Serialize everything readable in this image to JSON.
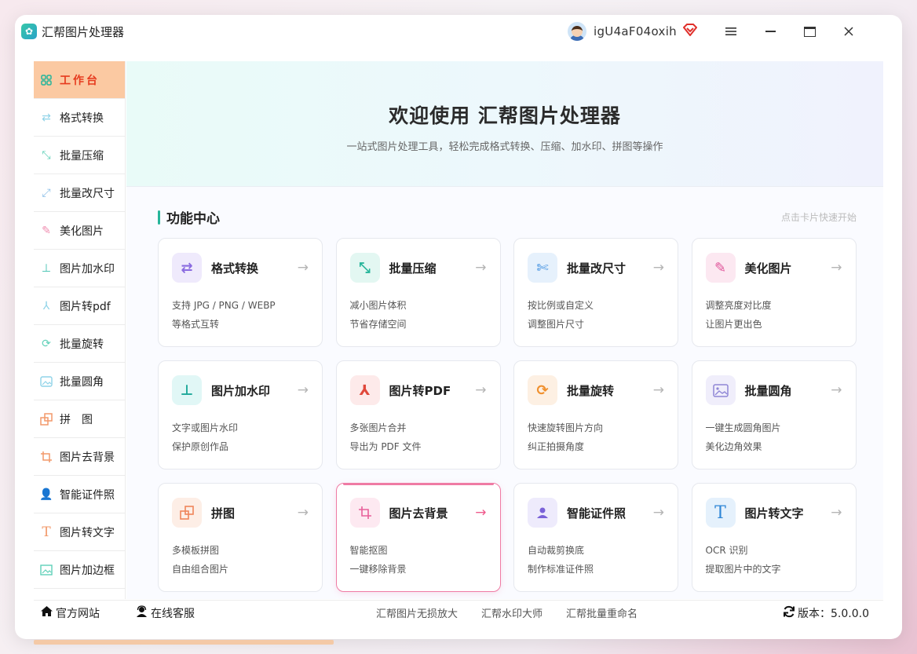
{
  "app": {
    "title": "汇帮图片处理器"
  },
  "user": {
    "name": "igU4aF04oxih"
  },
  "sidebar": {
    "items": [
      {
        "label": "工作台",
        "icon": "dashboard-icon",
        "active": true
      },
      {
        "label": "格式转换",
        "icon": "convert-icon"
      },
      {
        "label": "批量压缩",
        "icon": "compress-icon"
      },
      {
        "label": "批量改尺寸",
        "icon": "resize-icon"
      },
      {
        "label": "美化图片",
        "icon": "beautify-icon"
      },
      {
        "label": "图片加水印",
        "icon": "watermark-icon"
      },
      {
        "label": "图片转pdf",
        "icon": "pdf-icon"
      },
      {
        "label": "批量旋转",
        "icon": "rotate-icon"
      },
      {
        "label": "批量圆角",
        "icon": "round-corner-icon"
      },
      {
        "label": "拼　图",
        "icon": "collage-icon"
      },
      {
        "label": "图片去背景",
        "icon": "crop-icon"
      },
      {
        "label": "智能证件照",
        "icon": "person-icon"
      },
      {
        "label": "图片转文字",
        "icon": "text-icon"
      },
      {
        "label": "图片加边框",
        "icon": "frame-icon"
      }
    ]
  },
  "hero": {
    "title": "欢迎使用 汇帮图片处理器",
    "subtitle": "一站式图片处理工具，轻松完成格式转换、压缩、加水印、拼图等操作"
  },
  "section": {
    "title": "功能中心",
    "hint": "点击卡片快速开始"
  },
  "cards": [
    {
      "title": "格式转换",
      "desc1": "支持 JPG / PNG / WEBP",
      "desc2": "等格式互转",
      "arrow": "→"
    },
    {
      "title": "批量压缩",
      "desc1": "减小图片体积",
      "desc2": "节省存储空间",
      "arrow": "→"
    },
    {
      "title": "批量改尺寸",
      "desc1": "按比例或自定义",
      "desc2": "调整图片尺寸",
      "arrow": "→"
    },
    {
      "title": "美化图片",
      "desc1": "调整亮度对比度",
      "desc2": "让图片更出色",
      "arrow": "→"
    },
    {
      "title": "图片加水印",
      "desc1": "文字或图片水印",
      "desc2": "保护原创作品",
      "arrow": "→"
    },
    {
      "title": "图片转PDF",
      "desc1": "多张图片合并",
      "desc2": "导出为 PDF 文件",
      "arrow": "→"
    },
    {
      "title": "批量旋转",
      "desc1": "快速旋转图片方向",
      "desc2": "纠正拍摄角度",
      "arrow": "→"
    },
    {
      "title": "批量圆角",
      "desc1": "一键生成圆角图片",
      "desc2": "美化边角效果",
      "arrow": "→"
    },
    {
      "title": "拼图",
      "desc1": "多模板拼图",
      "desc2": "自由组合图片",
      "arrow": "→"
    },
    {
      "title": "图片去背景",
      "desc1": "智能抠图",
      "desc2": "一键移除背景",
      "arrow": "→"
    },
    {
      "title": "智能证件照",
      "desc1": "自动裁剪换底",
      "desc2": "制作标准证件照",
      "arrow": "→"
    },
    {
      "title": "图片转文字",
      "desc1": "OCR 识别",
      "desc2": "提取图片中的文字",
      "arrow": "→"
    }
  ],
  "footer": {
    "website": "官方网站",
    "support": "在线客服",
    "links": [
      "汇帮图片无损放大",
      "汇帮水印大师",
      "汇帮批量重命名"
    ],
    "version": "版本：5.0.0.0"
  },
  "colors": {
    "accent": "#26b59a",
    "sidebar_active_bg": "#fbc9a2",
    "sidebar_active_text": "#e63b1f",
    "hover_border": "#ef7ba4"
  }
}
